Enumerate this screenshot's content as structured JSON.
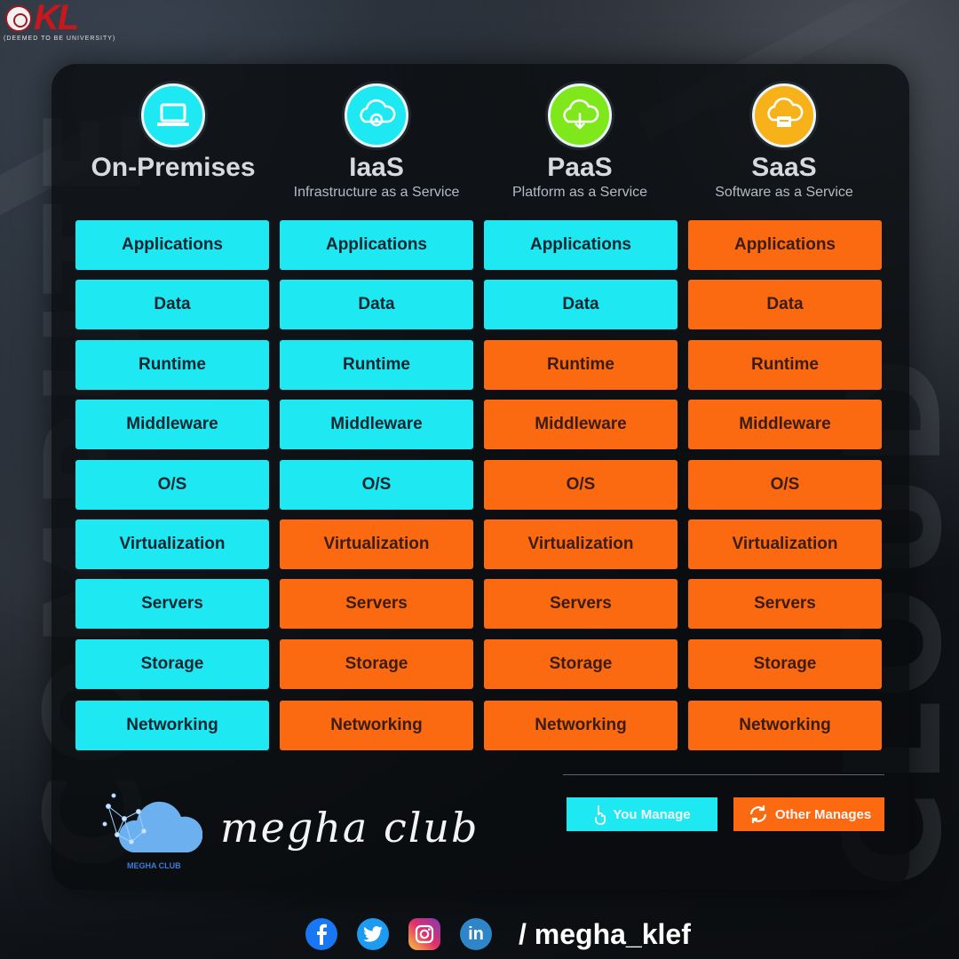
{
  "branding": {
    "kl_letters": "KL",
    "kl_subtitle": "(DEEMED TO BE UNIVERSITY)",
    "club_caption": "MEGHA CLUB",
    "script_title": "megha club"
  },
  "columns": [
    {
      "title": "On-Premises",
      "subtitle": "",
      "icon": "laptop-icon",
      "icon_color": "#1ee9f3",
      "cells": [
        "Applications",
        "Data",
        "Runtime",
        "Middleware",
        "O/S",
        "Virtualization",
        "Servers",
        "Storage",
        "Networking"
      ],
      "managed_by": [
        "you",
        "you",
        "you",
        "you",
        "you",
        "you",
        "you",
        "you",
        "you"
      ]
    },
    {
      "title": "IaaS",
      "subtitle": "Infrastructure as a Service",
      "icon": "cloud-gear-icon",
      "icon_color": "#1ee9f3",
      "cells": [
        "Applications",
        "Data",
        "Runtime",
        "Middleware",
        "O/S",
        "Virtualization",
        "Servers",
        "Storage",
        "Networking"
      ],
      "managed_by": [
        "you",
        "you",
        "you",
        "you",
        "you",
        "other",
        "other",
        "other",
        "other"
      ]
    },
    {
      "title": "PaaS",
      "subtitle": "Platform as a Service",
      "icon": "cloud-download-icon",
      "icon_color": "#7fe81a",
      "cells": [
        "Applications",
        "Data",
        "Runtime",
        "Middleware",
        "O/S",
        "Virtualization",
        "Servers",
        "Storage",
        "Networking"
      ],
      "managed_by": [
        "you",
        "you",
        "other",
        "other",
        "other",
        "other",
        "other",
        "other",
        "other"
      ]
    },
    {
      "title": "SaaS",
      "subtitle": "Software as a Service",
      "icon": "cloud-window-icon",
      "icon_color": "#f7b21a",
      "cells": [
        "Applications",
        "Data",
        "Runtime",
        "Middleware",
        "O/S",
        "Virtualization",
        "Servers",
        "Storage",
        "Networking"
      ],
      "managed_by": [
        "other",
        "other",
        "other",
        "other",
        "other",
        "other",
        "other",
        "other",
        "other"
      ]
    }
  ],
  "legend": {
    "you_label": "You Manage",
    "other_label": "Other Manages"
  },
  "colors": {
    "you_manage": "#1ee9f3",
    "other_manages": "#fb6a10"
  },
  "social": {
    "icons": [
      "facebook-icon",
      "twitter-icon",
      "instagram-icon",
      "linkedin-icon"
    ],
    "linkedin_text": "in",
    "handle": "/ megha_klef"
  }
}
